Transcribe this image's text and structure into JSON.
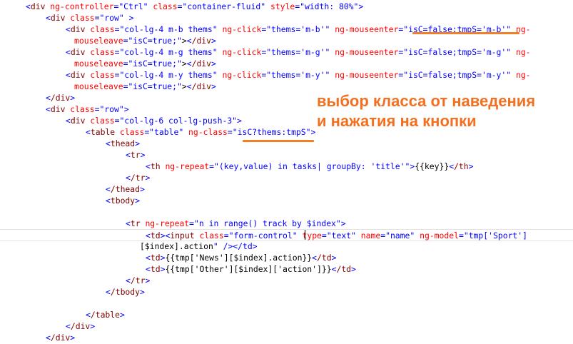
{
  "code_lines": [
    "<div ng-controller=\"Ctrl\" class=\"container-fluid\" style=\"width: 80%\">",
    "<div class=\"row\" >",
    "<div class=\"col-lg-4 m-b thems\" ng-click=\"thems='m-b'\" ng-mouseenter=\"isC=false;tmpS='m-b'\" ng-",
    "mouseleave=\"isC=true;\"></div>",
    "<div class=\"col-lg-4 m-g thems\" ng-click=\"thems='m-g'\" ng-mouseenter=\"isC=false;tmpS='m-g'\" ng-",
    "mouseleave=\"isC=true;\"></div>",
    "<div class=\"col-lg-4 m-y thems\" ng-click=\"thems='m-y'\" ng-mouseenter=\"isC=false;tmpS='m-y'\" ng-",
    "mouseleave=\"isC=true;\"></div>",
    "</div>",
    "<div class=\"row\">",
    "<div class=\"col-lg-6 col-lg-push-3\">",
    "<table class=\"table\" ng-class=\"isC?thems:tmpS\">",
    "<thead>",
    "<tr>",
    "<th ng-repeat=\"(key,value) in tasks| groupBy: 'title'\">{{key}}</th>",
    "</tr>",
    "</thead>",
    "<tbody>",
    "",
    "<tr ng-repeat=\"n in range() track by $index\">",
    "<td><input class=\"form-control\" type=\"text\" name=\"name\" ng-model=\"tmp['Sport']",
    "[$index].action\" /></td>",
    "<td>{{tmp['News'][$index].action}}</td>",
    "<td>{{tmp['Other'][$index]['action']}}</td>",
    "</tr>",
    "</tbody>",
    "",
    "</table>",
    "</div>",
    "</div>"
  ],
  "annotation": {
    "line1": "выбор класса от наведения",
    "line2": "и нажатия на кнопки",
    "color": "#f37021"
  },
  "syntax_colors": {
    "tag": "#800000",
    "attribute": "#ff0000",
    "value": "#0000ff",
    "highlight": "#f08023"
  }
}
